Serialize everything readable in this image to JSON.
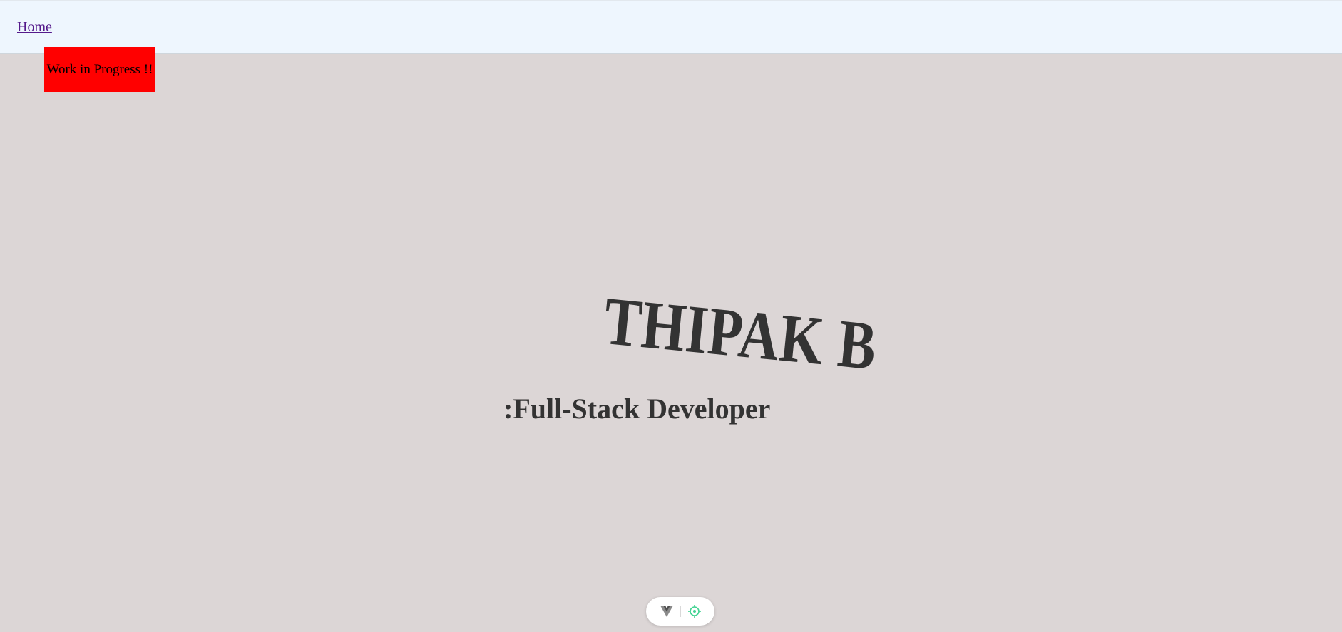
{
  "nav": {
    "home_label": "Home"
  },
  "banner": {
    "label": "Work in Progress !!",
    "color": "#ff0000"
  },
  "hero": {
    "name": "THIPAK B",
    "role": ":Full-Stack Developer",
    "text_color": "#333333"
  },
  "devtools": {
    "icons": [
      "vue-logo-icon",
      "target-icon"
    ],
    "accent": "#42d392"
  },
  "colors": {
    "page_bg": "#dcd6d6",
    "topbar_bg": "#eef6fe",
    "link": "#551a8b"
  }
}
